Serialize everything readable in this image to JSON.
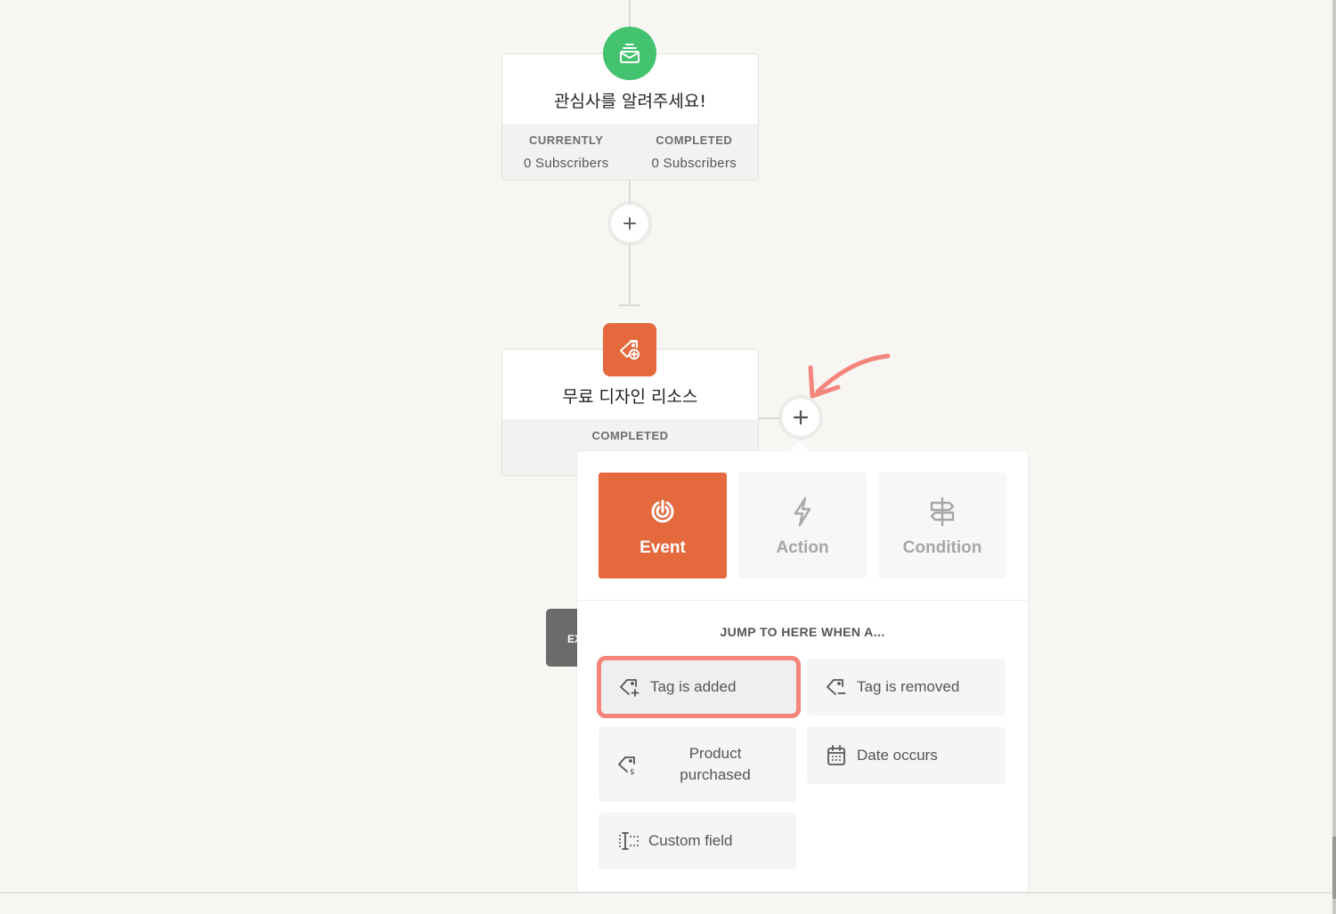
{
  "canvas": {
    "background": "#f7f6f3"
  },
  "nodes": [
    {
      "type": "email",
      "icon": "email-icon",
      "color": "#43c270",
      "title": "관심사를 알려주세요!",
      "stats": [
        {
          "label": "CURRENTLY",
          "value": "0 Subscribers"
        },
        {
          "label": "COMPLETED",
          "value": "0 Subscribers"
        }
      ]
    },
    {
      "type": "tag-event",
      "icon": "tag-add-icon",
      "color": "#e4693d",
      "title": "무료 디자인 리소스",
      "stats": [
        {
          "label": "COMPLETED",
          "value": ""
        }
      ]
    }
  ],
  "add_buttons": [
    {
      "label": "+"
    },
    {
      "label": "+"
    }
  ],
  "exit_node": {
    "label": "EXIT"
  },
  "popover": {
    "tabs": [
      {
        "label": "Event",
        "icon": "event-target-icon",
        "active": true
      },
      {
        "label": "Action",
        "icon": "lightning-icon",
        "active": false
      },
      {
        "label": "Condition",
        "icon": "signpost-icon",
        "active": false
      }
    ],
    "heading": "JUMP TO HERE WHEN A...",
    "triggers": [
      {
        "label": "Tag is added",
        "icon": "tag-add-icon",
        "highlighted": true
      },
      {
        "label": "Tag is removed",
        "icon": "tag-remove-icon",
        "highlighted": false
      },
      {
        "label": "Product purchased",
        "icon": "tag-dollar-icon",
        "highlighted": false
      },
      {
        "label": "Date occurs",
        "icon": "calendar-icon",
        "highlighted": false
      },
      {
        "label": "Custom field",
        "icon": "text-cursor-icon",
        "highlighted": false
      }
    ]
  },
  "colors": {
    "accent": "#e4693d",
    "success": "#43c270",
    "highlight": "#f3857a"
  }
}
